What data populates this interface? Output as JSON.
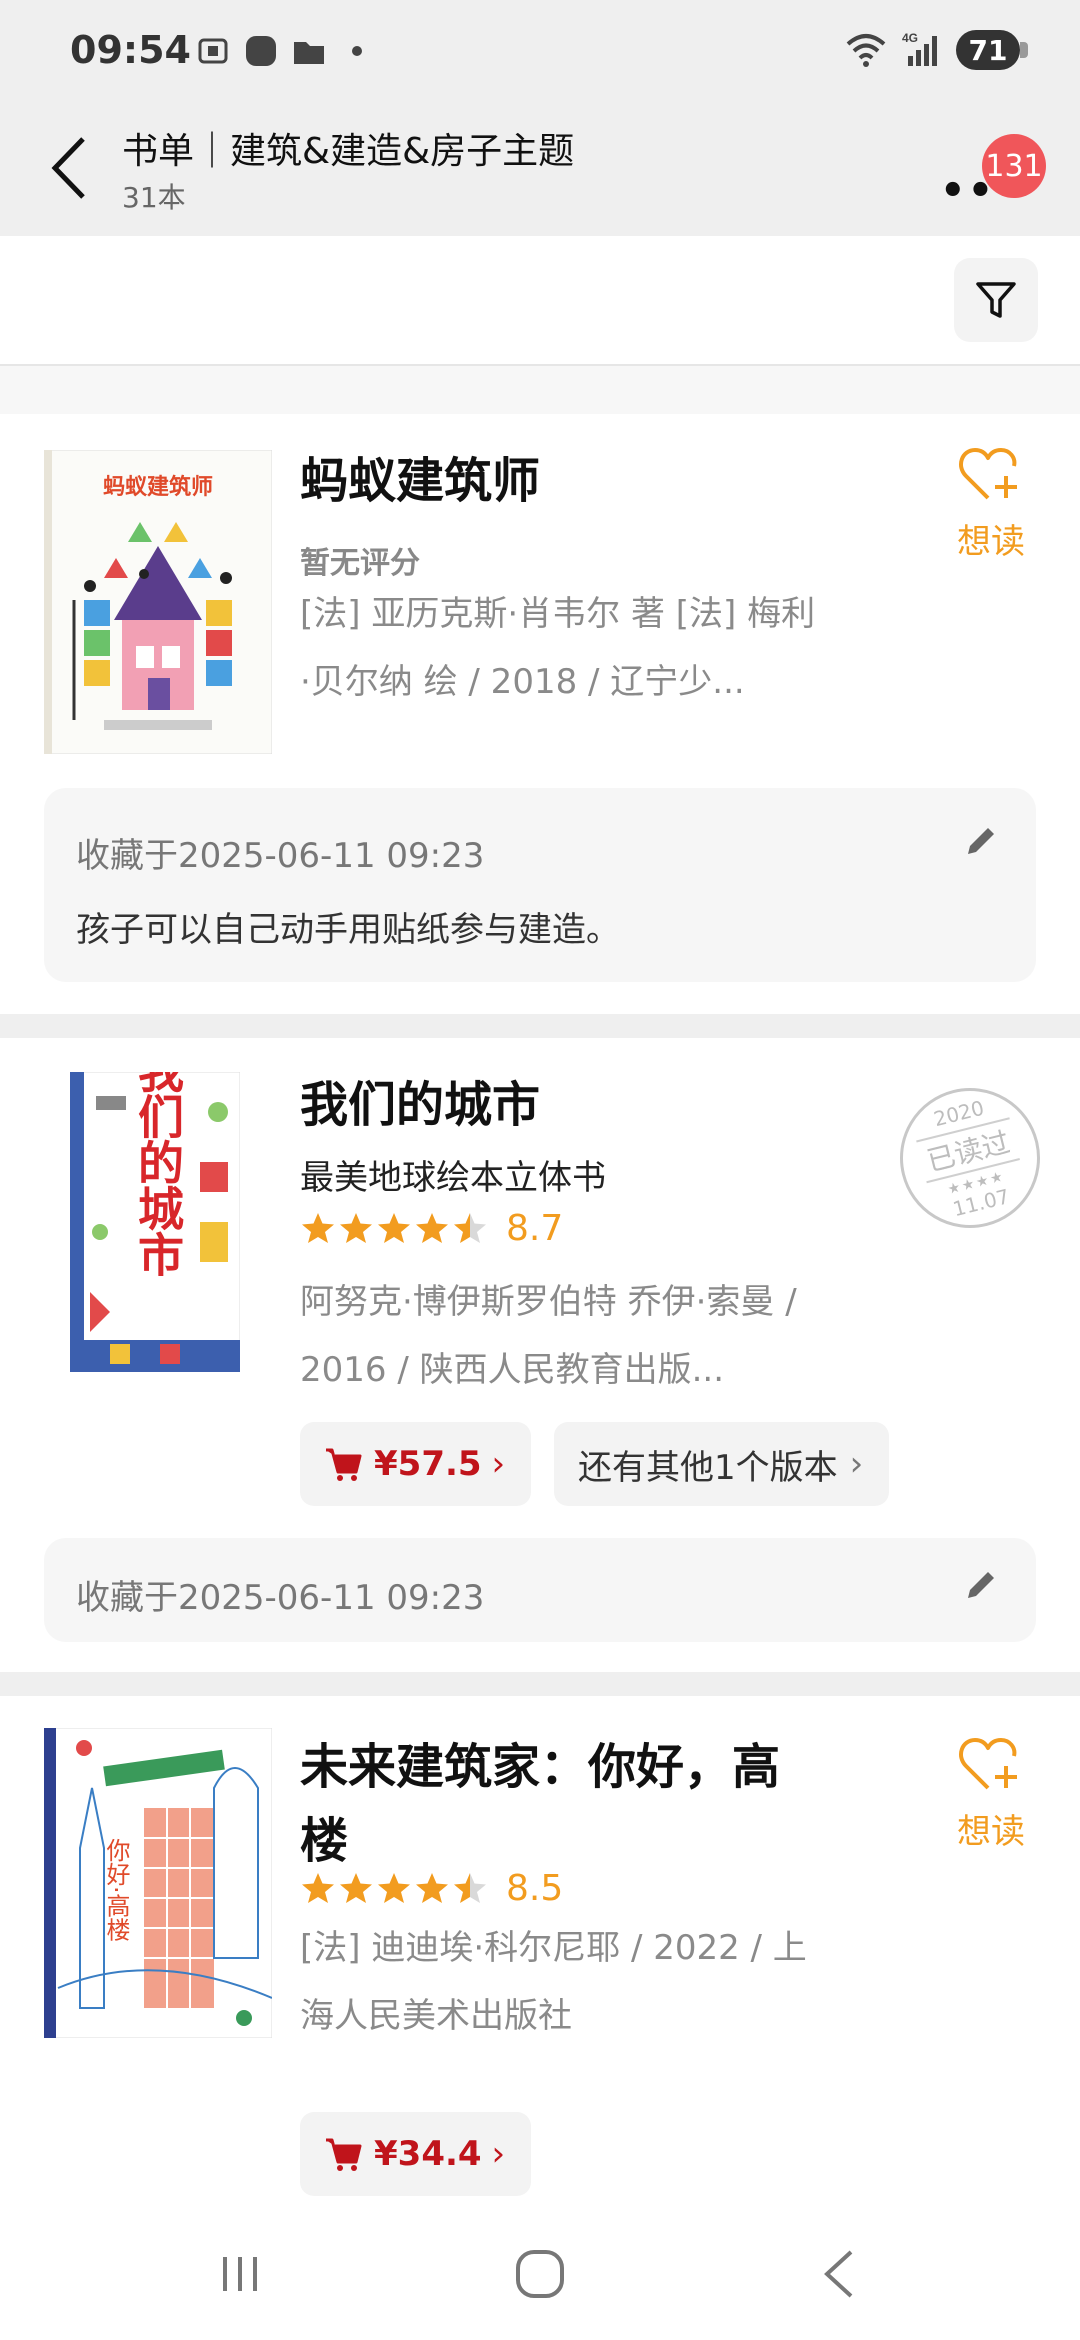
{
  "status_bar": {
    "time": "09:54",
    "battery": "71",
    "network": "4G"
  },
  "header": {
    "title": "书单｜建筑&建造&房子主题",
    "count": "31本",
    "notification_count": "131"
  },
  "books": [
    {
      "title": "蚂蚁建筑师",
      "rating_text": "暂无评分",
      "meta": "[法] 亚历克斯·肖韦尔 著 [法] 梅利·贝尔纳 绘 / 2018 / 辽宁少...",
      "want_label": "想读",
      "cover_text": "蚂蚁建筑师",
      "note_time": "收藏于2025-06-11 09:23",
      "note_text": "孩子可以自己动手用贴纸参与建造。"
    },
    {
      "title": "我们的城市",
      "subtitle": "最美地球绘本立体书",
      "rating": 4.5,
      "score": "8.7",
      "meta": "阿努克·博伊斯罗伯特 乔伊·索曼 / 2016 / 陕西人民教育出版...",
      "price": "¥57.5",
      "versions_label": "还有其他1个版本",
      "cover_text": "我们的城市",
      "stamp": {
        "year": "2020",
        "label": "已读过",
        "date": "11.07"
      },
      "note_time": "收藏于2025-06-11 09:23"
    },
    {
      "title": "未来建筑家：你好，高楼",
      "rating": 4.5,
      "score": "8.5",
      "meta": "[法] 迪迪埃·科尔尼耶 / 2022 / 上海人民美术出版社",
      "want_label": "想读",
      "price": "¥34.4",
      "cover_text": "你好·高楼"
    }
  ],
  "colors": {
    "accent": "#f29c1f",
    "price": "#c0141b",
    "badge": "#f0565a"
  }
}
